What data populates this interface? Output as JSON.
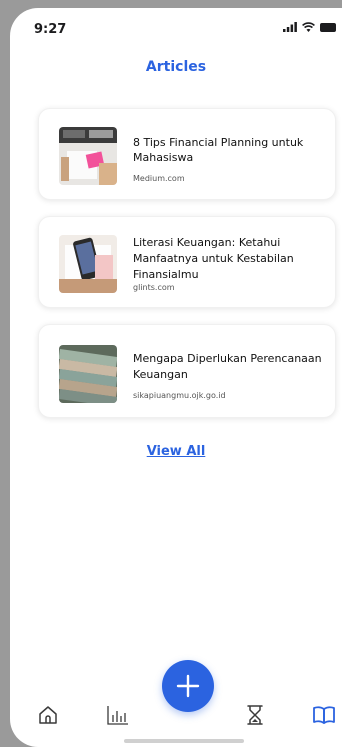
{
  "status_bar": {
    "time": "9:27"
  },
  "header": {
    "title": "Articles"
  },
  "articles": [
    {
      "title": "8 Tips Financial Planning untuk Mahasiswa",
      "source": "Medium.com"
    },
    {
      "title": "Literasi Keuangan: Ketahui Manfaatnya untuk Kestabilan Finansialmu",
      "source": "glints.com"
    },
    {
      "title": "Mengapa Diperlukan Perencanaan Keuangan",
      "source": "sikapiuangmu.ojk.go.id"
    }
  ],
  "view_all_label": "View All",
  "bottom_nav": {
    "items": [
      "home-icon",
      "bar-chart-icon",
      "add-icon",
      "hourglass-icon",
      "book-icon"
    ],
    "active": "book-icon",
    "accent": "#2b63e0"
  }
}
